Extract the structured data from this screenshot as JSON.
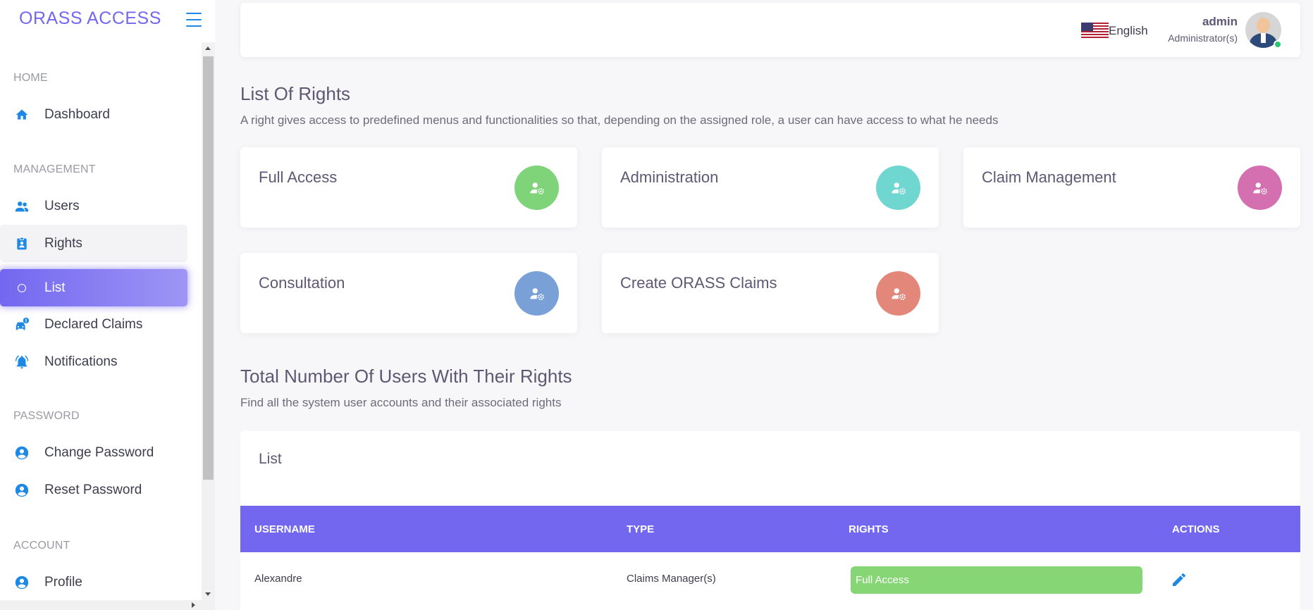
{
  "sidebar": {
    "brand": "ORASS ACCESS",
    "sections": {
      "home": "HOME",
      "management": "MANAGEMENT",
      "password": "PASSWORD",
      "account": "ACCOUNT"
    },
    "items": {
      "dashboard": "Dashboard",
      "users": "Users",
      "rights": "Rights",
      "list": "List",
      "declared_claims": "Declared Claims",
      "notifications": "Notifications",
      "change_password": "Change Password",
      "reset_password": "Reset Password",
      "profile": "Profile"
    }
  },
  "topbar": {
    "language": "English",
    "user_name": "admin",
    "user_role": "Administrator(s)"
  },
  "rights_section": {
    "title": "List Of Rights",
    "subtitle": "A right gives access to predefined menus and functionalities so that, depending on the assigned role, a user can have access to what he needs",
    "cards": [
      {
        "label": "Full Access",
        "color": "#7fd47a"
      },
      {
        "label": "Administration",
        "color": "#6fd6d0"
      },
      {
        "label": "Claim Management",
        "color": "#d46fb0"
      },
      {
        "label": "Consultation",
        "color": "#79a1d8"
      },
      {
        "label": "Create ORASS Claims",
        "color": "#e2877a"
      }
    ]
  },
  "users_section": {
    "title": "Total Number Of Users With Their Rights",
    "subtitle": "Find all the system user accounts and their associated rights",
    "card_title": "List",
    "columns": {
      "username": "USERNAME",
      "type": "TYPE",
      "rights": "RIGHTS",
      "actions": "ACTIONS"
    },
    "rows": [
      {
        "username": "Alexandre",
        "type": "Claims Manager(s)",
        "rights": "Full Access"
      }
    ]
  },
  "colors": {
    "accent": "#7367f0",
    "icon_blue": "#1e88e5"
  }
}
